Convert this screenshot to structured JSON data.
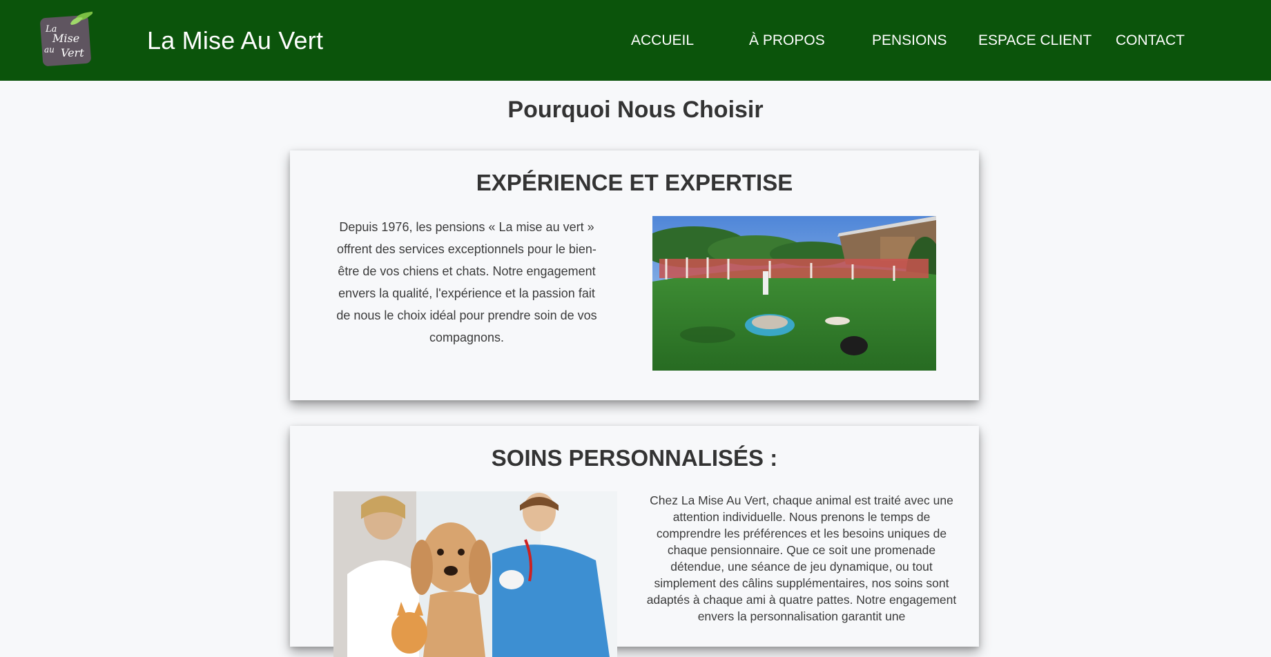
{
  "header": {
    "site_title": "La Mise Au Vert",
    "logo_text": "La Mise au Vert",
    "nav": [
      {
        "label": "ACCUEIL"
      },
      {
        "label": "À PROPOS"
      },
      {
        "label": "PENSIONS"
      },
      {
        "label": "ESPACE CLIENT"
      },
      {
        "label": "CONTACT"
      }
    ]
  },
  "main": {
    "title": "Pourquoi Nous Choisir",
    "cards": [
      {
        "title": "EXPÉRIENCE ET EXPERTISE",
        "text": "Depuis 1976, les pensions « La mise au vert » offrent des services exceptionnels pour le bien-être de vos chiens et chats. Notre engagement envers la qualité, l'expérience et la passion fait de nous le choix idéal pour prendre soin de vos compagnons.",
        "image": "dog-garden-photo"
      },
      {
        "title": "SOINS PERSONNALISÉS :",
        "text": "Chez La Mise Au Vert, chaque animal est traité avec une attention individuelle. Nous prenons le temps de comprendre les préférences et les besoins uniques de chaque pensionnaire. Que ce soit une promenade détendue, une séance de jeu dynamique, ou tout simplement des câlins supplémentaires, nos soins sont adaptés à chaque ami à quatre pattes. Notre engagement envers la personnalisation garantit une",
        "image": "vet-dog-cat-photo"
      }
    ]
  },
  "colors": {
    "header_bg": "#0b540b",
    "page_bg": "#f7f8fa",
    "logo_bg": "#5f5560",
    "leaf": "#7bc043"
  }
}
